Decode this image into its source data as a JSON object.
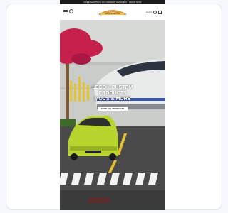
{
  "announcement": {
    "text": "FREE SHIPPING ON ORDERS OVER $99 · SHOP NOW"
  },
  "header": {
    "logo_text": "BRICK SHOP",
    "login_label": "Log in"
  },
  "hero": {
    "title_lines": [
      "LEGO® CUSTOM",
      "PRODUCTS",
      "MOCS & MORE"
    ],
    "button_label": "SHOP ALL PRODUCTS"
  },
  "colors": {
    "accent": "#e8a431",
    "tree": "#c6204c",
    "car": "#b7d32e",
    "train": "#e6e6e6"
  }
}
